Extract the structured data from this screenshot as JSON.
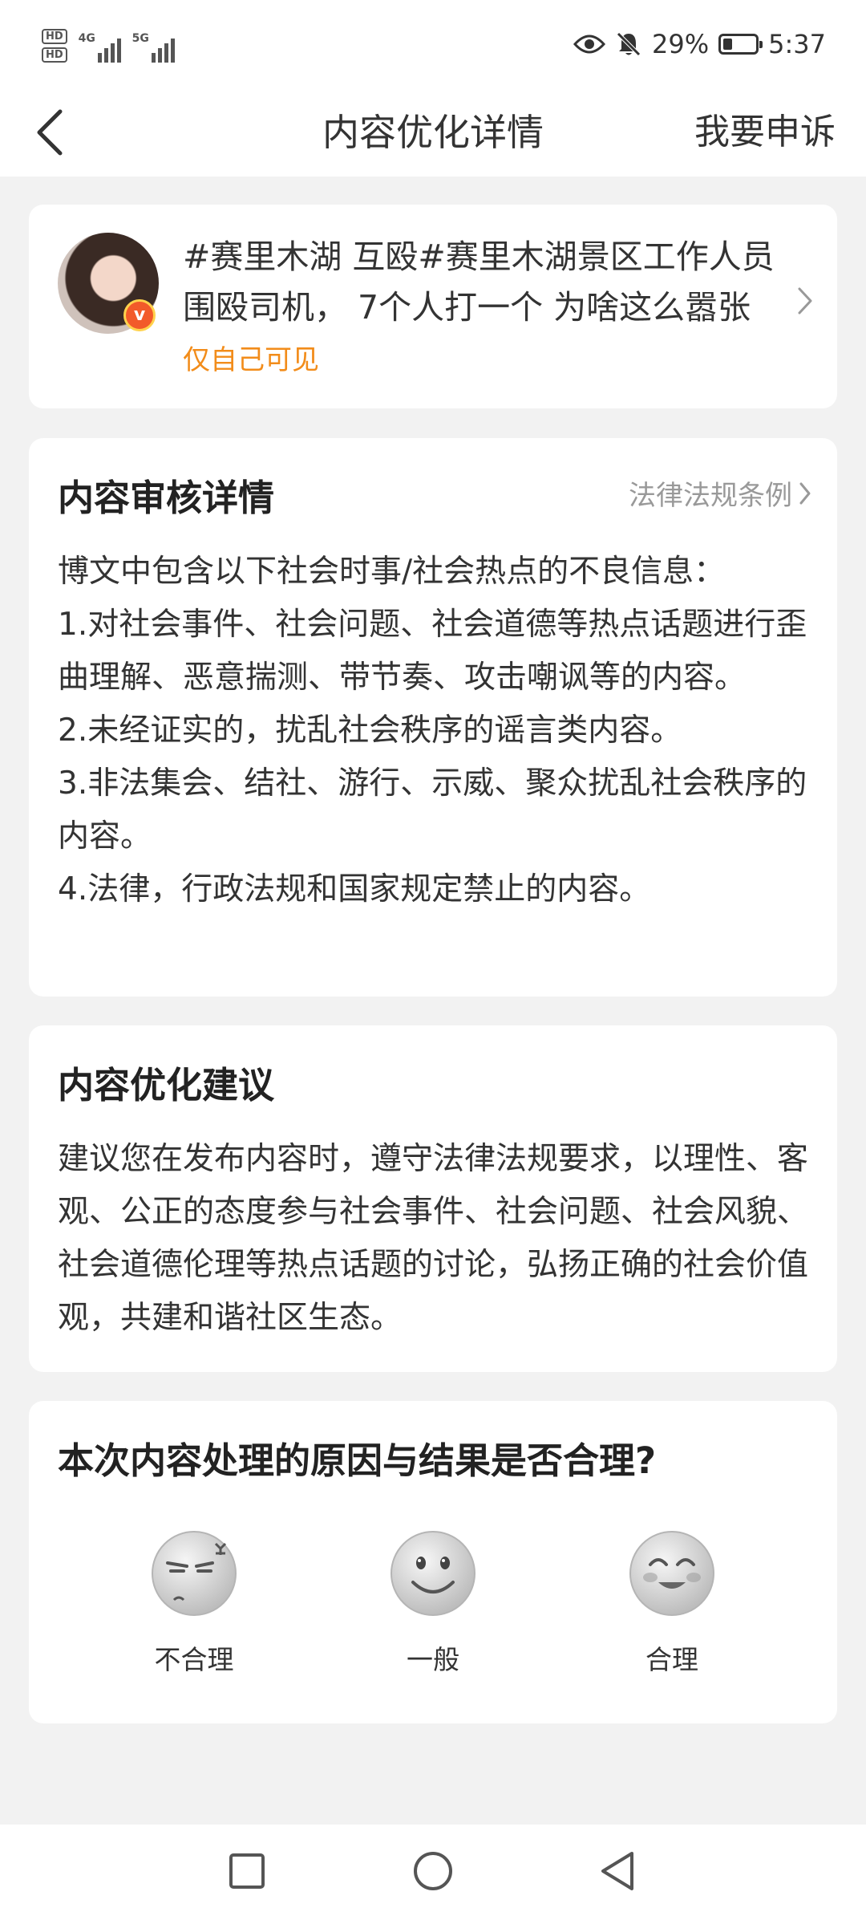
{
  "status_bar": {
    "hd_top": "HD",
    "hd_bottom": "HD",
    "net1": "4G",
    "net2": "5G",
    "battery_text": "29%",
    "battery_level": 0.29,
    "time": "5:37"
  },
  "nav": {
    "title": "内容优化详情",
    "appeal": "我要申诉"
  },
  "post": {
    "text": "#赛里木湖 互殴#赛里木湖景区工作人员围殴司机， 7个人打一个 为啥这么嚣张",
    "visibility": "仅自己可见"
  },
  "review": {
    "title": "内容审核详情",
    "law_link": "法律法规条例",
    "lines": [
      "博文中包含以下社会时事/社会热点的不良信息：",
      "1.对社会事件、社会问题、社会道德等热点话题进行歪曲理解、恶意揣测、带节奏、攻击嘲讽等的内容。",
      "2.未经证实的，扰乱社会秩序的谣言类内容。",
      "3.非法集会、结社、游行、示威、聚众扰乱社会秩序的内容。",
      "4.法律，行政法规和国家规定禁止的内容。"
    ]
  },
  "suggestion": {
    "title": "内容优化建议",
    "body": "建议您在发布内容时，遵守法律法规要求，以理性、客观、公正的态度参与社会事件、社会问题、社会风貌、社会道德伦理等热点话题的讨论，弘扬正确的社会价值观，共建和谐社区生态。"
  },
  "feedback": {
    "question": "本次内容处理的原因与结果是否合理?",
    "options": [
      "不合理",
      "一般",
      "合理"
    ]
  },
  "colors": {
    "orange": "#f28c1a",
    "background": "#f2f2f2",
    "card": "#ffffff"
  }
}
